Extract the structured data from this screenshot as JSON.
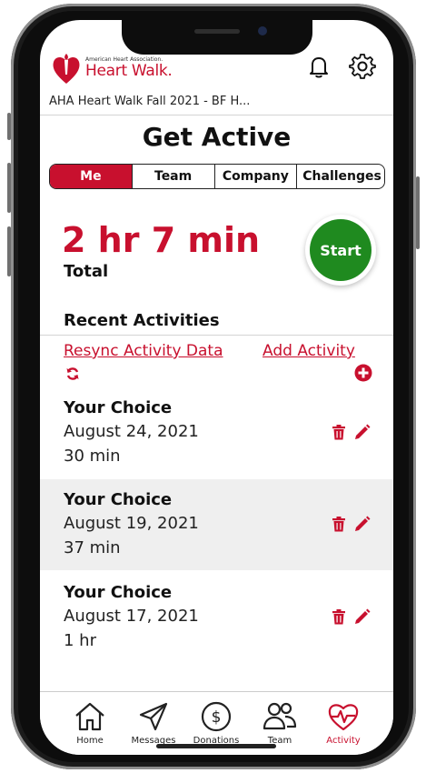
{
  "header": {
    "org_small": "American Heart Association.",
    "brand": "Heart Walk.",
    "event_title": "AHA Heart Walk Fall 2021 - BF H..."
  },
  "page": {
    "title": "Get Active"
  },
  "tabs": [
    {
      "label": "Me"
    },
    {
      "label": "Team"
    },
    {
      "label": "Company"
    },
    {
      "label": "Challenges"
    }
  ],
  "total": {
    "value": "2 hr 7 min",
    "label": "Total"
  },
  "start_button": {
    "label": "Start"
  },
  "recent": {
    "title": "Recent Activities",
    "resync_label": "Resync Activity Data",
    "add_label": "Add Activity"
  },
  "activities": [
    {
      "name": "Your Choice",
      "date": "August 24, 2021",
      "duration": "30 min"
    },
    {
      "name": "Your Choice",
      "date": "August 19, 2021",
      "duration": "37 min"
    },
    {
      "name": "Your Choice",
      "date": "August 17, 2021",
      "duration": "1 hr"
    }
  ],
  "nav": [
    {
      "label": "Home",
      "icon": "home-icon"
    },
    {
      "label": "Messages",
      "icon": "send-icon"
    },
    {
      "label": "Donations",
      "icon": "dollar-icon"
    },
    {
      "label": "Team",
      "icon": "people-icon"
    },
    {
      "label": "Activity",
      "icon": "heart-pulse-icon"
    }
  ],
  "colors": {
    "accent": "#c8102e",
    "start": "#1f8a1f"
  }
}
